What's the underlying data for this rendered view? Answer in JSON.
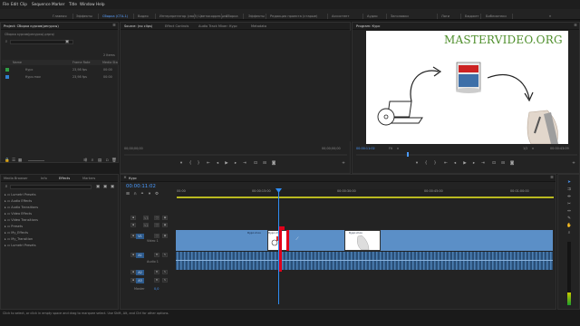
{
  "menubar": {
    "items": [
      "File",
      "Edit",
      "Clip",
      "Sequence",
      "Marker",
      "Title",
      "Window",
      "Help"
    ]
  },
  "workspaces": {
    "tabs": [
      "Главная",
      "Эффекты",
      "Сборка (СТА-1)",
      "Видео",
      "Интерпретатор (свой)",
      "Цветокоррекция",
      "Сборка",
      "Эффекты",
      "Редакция проекта (старые)",
      "Ассистент",
      "Аудио",
      "Заголовки",
      "Логи",
      "Бюджет",
      "Библиотеки"
    ],
    "active_index": 2
  },
  "project": {
    "tab": "Project: Сборка курсов(ресурсы)",
    "path": "Сборка курсов(ресурсы).prproj",
    "count": "2 Items",
    "columns": {
      "name": "Name",
      "rate": "Frame Rate",
      "start": "Media Sta"
    },
    "items": [
      {
        "name": "Курс",
        "rate": "23,98 fps",
        "start": "00:00",
        "color": "#2f9e44"
      },
      {
        "name": "Курс.mov",
        "rate": "23,98 fps",
        "start": "00:00",
        "color": "#2f7fd0"
      }
    ]
  },
  "source": {
    "tabs": [
      "Source: (no clips)",
      "Effect Controls",
      "Audio Track Mixer: Курс",
      "Metadata"
    ],
    "tc_left": "00;00;00;00",
    "tc_right": "00;00;00;00"
  },
  "program": {
    "tab": "Program: Курс",
    "tc_left": "00:00:11:02",
    "fit": "Fit",
    "ratio": "1/2",
    "tc_right": "00:00:43:09",
    "watermark": "MASTERVIDEO.ORG"
  },
  "effects": {
    "tabs": [
      "Media Browser",
      "Info",
      "Effects",
      "Markers"
    ],
    "active_index": 2,
    "tree": [
      "Lumetri Presets",
      "Audio Effects",
      "Audio Transitions",
      "Video Effects",
      "Video Transitions",
      "Presets",
      "My_Effects",
      "My_Transition",
      "Lumetri Presets"
    ]
  },
  "timeline": {
    "tab": "Курс",
    "timecode": "00:00:11:02",
    "ruler": [
      "00:00",
      "00:00:15:00",
      "00:00:30:00",
      "00:00:45:00",
      "00:01:00:00"
    ],
    "tracks": {
      "v3": "V3",
      "v2": "V2",
      "v1": "V1",
      "v1_name": "Video 1",
      "a1": "A1",
      "a1_name": "Audio 1",
      "a2": "A2",
      "a3": "A3",
      "master": "Master",
      "master_val": "0,0"
    },
    "clip_labels": [
      "Курс.mov",
      "Курс.mov",
      "Курс.mov"
    ]
  },
  "status": {
    "text": "Click to select, or click in empty space and drag to marquee select. Use Shift, Alt, and Ctrl for other options."
  },
  "colors": {
    "accent": "#4a9bff",
    "track_blue": "#5b8fc7",
    "playhead": "#2f8df5",
    "trim_red": "#e0001a"
  }
}
